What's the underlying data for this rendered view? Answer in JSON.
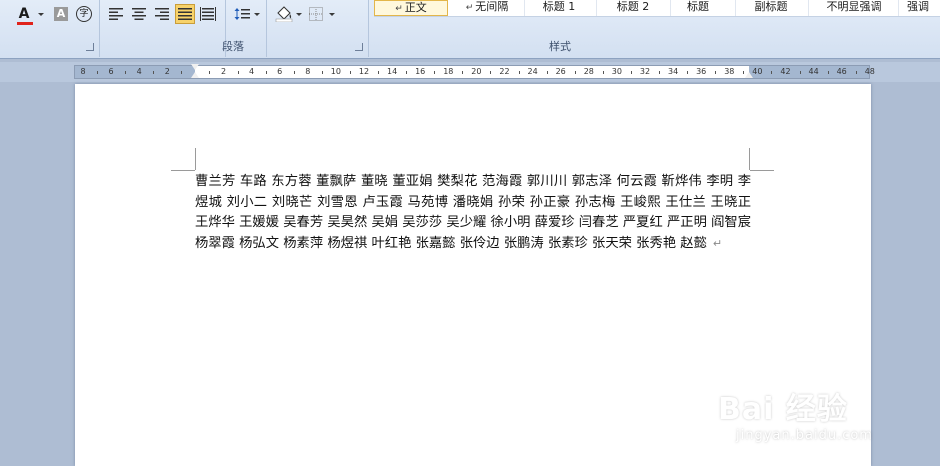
{
  "ribbon": {
    "paragraph_group_label": "段落",
    "styles_group_label": "样式",
    "styles": [
      {
        "label": "正文",
        "mark": "↵",
        "selected": true
      },
      {
        "label": "无间隔",
        "mark": "↵",
        "selected": false
      },
      {
        "label": "标题 1",
        "mark": "",
        "selected": false
      },
      {
        "label": "标题 2",
        "mark": "",
        "selected": false
      },
      {
        "label": "标题",
        "mark": "",
        "selected": false
      },
      {
        "label": "副标题",
        "mark": "",
        "selected": false
      },
      {
        "label": "不明显强调",
        "mark": "",
        "selected": false
      },
      {
        "label": "强调",
        "mark": "",
        "selected": false
      }
    ],
    "font_color_letter": "A",
    "char_shading_letter": "A",
    "enclose_char": "字",
    "colors": {
      "font_color": "#e0231b",
      "highlight": "#f7d26a",
      "accent": "#3b4e6b"
    }
  },
  "ruler": {
    "labels": [
      "8",
      "6",
      "4",
      "2",
      "",
      "2",
      "4",
      "6",
      "8",
      "10",
      "12",
      "14",
      "16",
      "18",
      "20",
      "22",
      "24",
      "26",
      "28",
      "30",
      "32",
      "34",
      "36",
      "38",
      "40",
      "42",
      "44",
      "46",
      "48"
    ]
  },
  "document": {
    "text": "曹兰芳 车路 东方蓉 董飘萨 董晓 董亚娟 樊梨花 范海霞 郭川川 郭志泽 何云霞 靳烨伟 李明 李煜城 刘小二 刘晓芒 刘雪恩 卢玉霞 马苑博 潘晓娟 孙荣 孙正豪 孙志梅 王峻熙 王仕兰 王晓正 王烨华 王媛媛 吴春芳 吴昊然 吴娟 吴莎莎 吴少耀 徐小明 薛爱珍 闫春芝 严夏红 严正明 阎智宸 杨翠霞 杨弘文 杨素萍 杨煜祺 叶红艳 张嘉懿 张伶边 张鹏涛 张素珍 张天荣 张秀艳 赵懿",
    "paragraph_mark": "↵"
  },
  "watermark": {
    "logo": "Bai 经验",
    "sub": "jingyan.baidu.com"
  }
}
